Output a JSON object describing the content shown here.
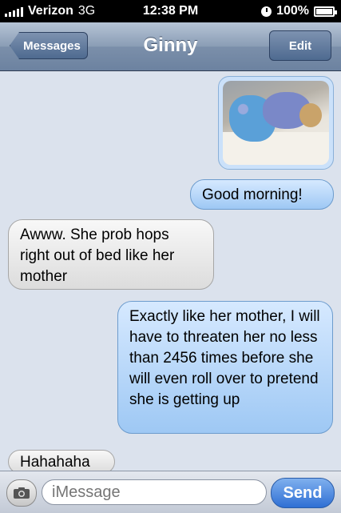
{
  "status_bar": {
    "carrier": "Verizon",
    "network": "3G",
    "time": "12:38 PM",
    "battery": "100%"
  },
  "nav": {
    "back_label": "Messages",
    "title": "Ginny",
    "edit_label": "Edit"
  },
  "messages": [
    {
      "from": "me",
      "type": "photo"
    },
    {
      "from": "me",
      "text": "Good morning!"
    },
    {
      "from": "them",
      "text": "Awww. She prob hops right out of bed like her mother"
    },
    {
      "from": "me",
      "text": "Exactly like her mother, I will have to threaten her no less than 2456 times before she will even roll over to pretend she is getting up"
    },
    {
      "from": "them",
      "text": "Hahahaha"
    }
  ],
  "composer": {
    "placeholder": "iMessage",
    "send_label": "Send"
  },
  "colors": {
    "sent_bubble": "#b7d6f8",
    "received_bubble": "#e8e8e8",
    "send_button": "#3f7ee0"
  }
}
